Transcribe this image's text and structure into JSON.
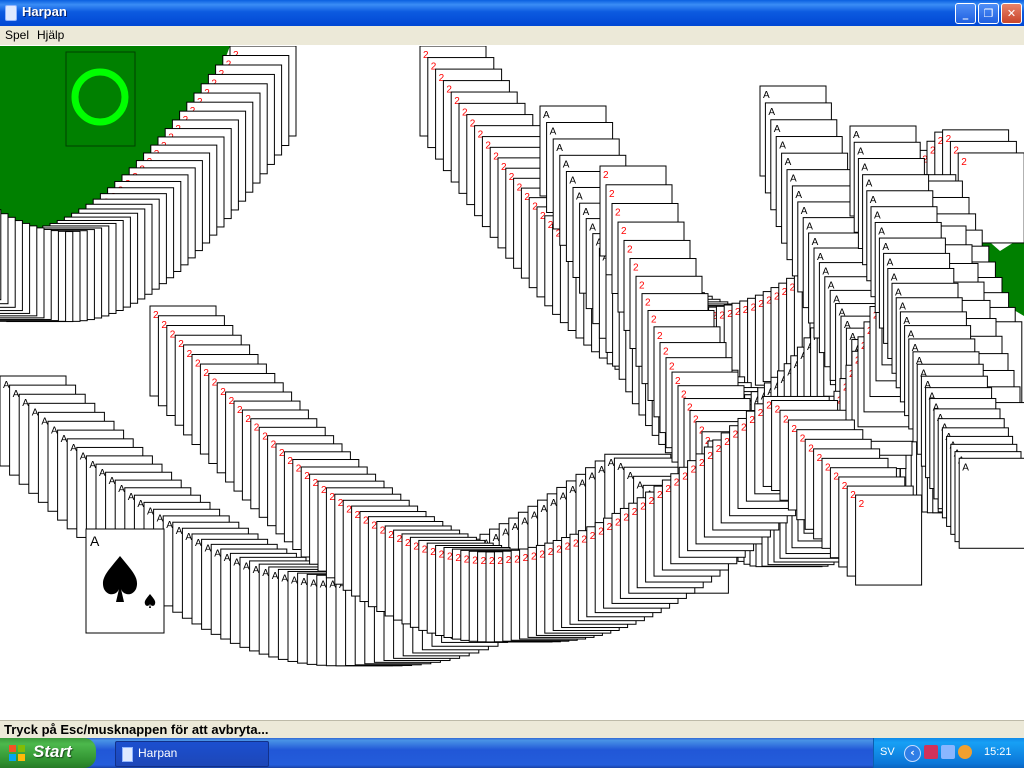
{
  "window": {
    "title": "Harpan",
    "minimize_glyph": "_",
    "maximize_glyph": "❐",
    "close_glyph": "✕"
  },
  "menu": {
    "items": [
      {
        "label": "Spel"
      },
      {
        "label": "Hjälp"
      }
    ]
  },
  "game": {
    "background_color": "#ffffff",
    "felt_color": "#008000",
    "slot_ring_color": "#00ff00",
    "red_suit_color": "#ff0000",
    "black_suit_color": "#000000",
    "featured_card": {
      "rank": "A",
      "suit": "spade-icon"
    },
    "red_rank_glyph": "2",
    "black_rank_glyph": "A"
  },
  "status": {
    "text": "Tryck på Esc/musknappen för att avbryta..."
  },
  "taskbar": {
    "start_label": "Start",
    "task_label": "Harpan",
    "language": "SV",
    "chevron": "‹",
    "clock": "15:21"
  }
}
